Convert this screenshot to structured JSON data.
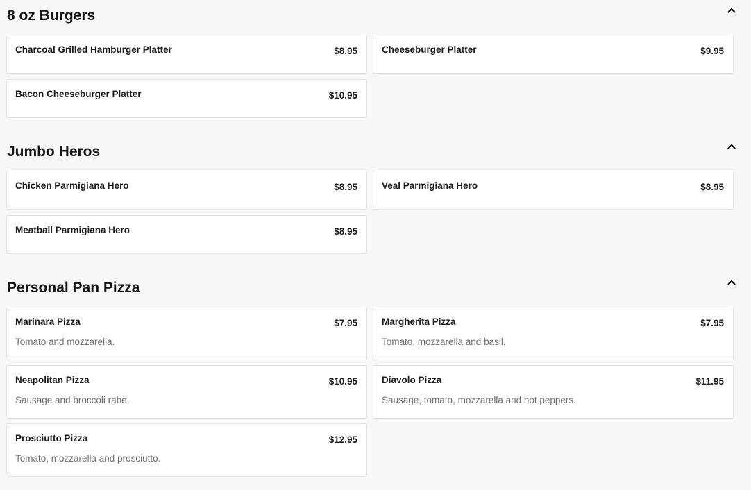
{
  "sections": [
    {
      "title": "8 oz Burgers",
      "collapse_icon": "chevron-up-icon",
      "items": [
        {
          "name": "Charcoal Grilled Hamburger Platter",
          "price": "$8.95"
        },
        {
          "name": "Cheeseburger Platter",
          "price": "$9.95"
        },
        {
          "name": "Bacon Cheeseburger Platter",
          "price": "$10.95"
        }
      ]
    },
    {
      "title": "Jumbo Heros",
      "collapse_icon": "chevron-up-icon",
      "items": [
        {
          "name": "Chicken Parmigiana Hero",
          "price": "$8.95"
        },
        {
          "name": "Veal Parmigiana Hero",
          "price": "$8.95"
        },
        {
          "name": "Meatball Parmigiana Hero",
          "price": "$8.95"
        }
      ]
    },
    {
      "title": "Personal Pan Pizza",
      "collapse_icon": "chevron-up-icon",
      "items": [
        {
          "name": "Marinara Pizza",
          "price": "$7.95",
          "description": "Tomato and mozzarella."
        },
        {
          "name": "Margherita Pizza",
          "price": "$7.95",
          "description": "Tomato, mozzarella and basil."
        },
        {
          "name": "Neapolitan Pizza",
          "price": "$10.95",
          "description": "Sausage and broccoli rabe."
        },
        {
          "name": "Diavolo Pizza",
          "price": "$11.95",
          "description": "Sausage, tomato, mozzarella and hot peppers."
        },
        {
          "name": "Prosciutto Pizza",
          "price": "$12.95",
          "description": "Tomato, mozzarella and prosciutto."
        }
      ]
    }
  ]
}
